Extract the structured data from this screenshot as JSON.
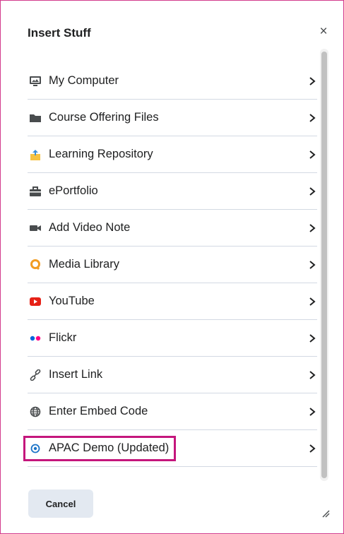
{
  "dialog": {
    "title": "Insert Stuff",
    "close_label": "×",
    "cancel_label": "Cancel"
  },
  "items": [
    {
      "label": "My Computer",
      "icon": "computer-icon"
    },
    {
      "label": "Course Offering Files",
      "icon": "folder-icon"
    },
    {
      "label": "Learning Repository",
      "icon": "repository-icon"
    },
    {
      "label": "ePortfolio",
      "icon": "briefcase-icon"
    },
    {
      "label": "Add Video Note",
      "icon": "video-camera-icon"
    },
    {
      "label": "Media Library",
      "icon": "media-library-icon"
    },
    {
      "label": "YouTube",
      "icon": "youtube-icon"
    },
    {
      "label": "Flickr",
      "icon": "flickr-icon"
    },
    {
      "label": "Insert Link",
      "icon": "link-icon"
    },
    {
      "label": "Enter Embed Code",
      "icon": "globe-icon"
    },
    {
      "label": "APAC Demo (Updated)",
      "icon": "target-icon",
      "highlighted": true
    }
  ],
  "colors": {
    "highlight_border": "#c4167c",
    "dialog_border": "#d33b8d",
    "youtube_red": "#e62117",
    "media_orange": "#f29c22",
    "flickr_blue": "#0063dc",
    "flickr_pink": "#ff0084",
    "target_blue": "#1a73c7"
  }
}
